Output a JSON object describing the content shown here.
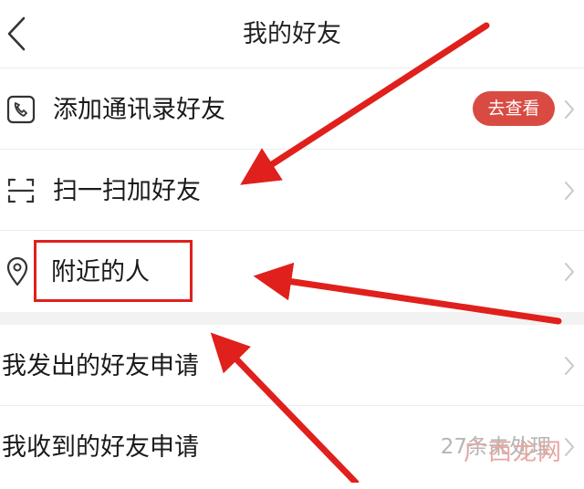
{
  "header": {
    "title": "我的好友"
  },
  "rows": {
    "contacts": {
      "label": "添加通讯录好友",
      "badge": "去查看"
    },
    "scan": {
      "label": "扫一扫加好友"
    },
    "nearby": {
      "label": "附近的人"
    },
    "sent_requests": {
      "label": "我发出的好友申请"
    },
    "received_requests": {
      "label": "我收到的好友申请",
      "value": "27条未处理"
    }
  },
  "annotations": {
    "highlight_color": "#e0201c",
    "arrow_color": "#e0201c"
  },
  "watermark": "广西龙网",
  "colors": {
    "badge": "#d94b42",
    "divider": "#ececec",
    "section_gap": "#f2f2f2"
  },
  "icons": {
    "back": "back-chevron-icon",
    "contacts": "phone-contact-icon",
    "scan": "scan-frame-icon",
    "nearby": "location-pin-icon",
    "chevron": "chevron-right-icon"
  }
}
